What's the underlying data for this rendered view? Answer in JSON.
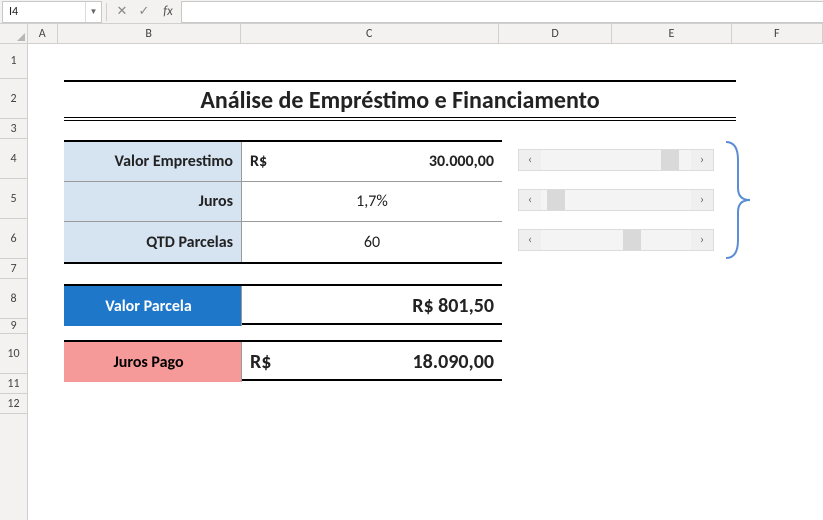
{
  "name_box": "I4",
  "formula_bar": {
    "cancel": "✕",
    "confirm": "✓",
    "fx": "fx",
    "value": ""
  },
  "columns": {
    "A": "A",
    "B": "B",
    "C": "C",
    "D": "D",
    "E": "E",
    "F": "F"
  },
  "rows": {
    "r1": "1",
    "r2": "2",
    "r3": "3",
    "r4": "4",
    "r5": "5",
    "r6": "6",
    "r7": "7",
    "r8": "8",
    "r9": "9",
    "r10": "10",
    "r11": "11",
    "r12": "12"
  },
  "title": "Análise de Empréstimo e Financiamento",
  "inputs": {
    "loan": {
      "label": "Valor Emprestimo",
      "prefix": "R$",
      "value": "30.000,00"
    },
    "rate": {
      "label": "Juros",
      "value": "1,7%"
    },
    "n": {
      "label": "QTD Parcelas",
      "value": "60"
    }
  },
  "outputs": {
    "installment": {
      "label": "Valor Parcela",
      "value": "R$ 801,50"
    },
    "interest_paid": {
      "label": "Juros Pago",
      "prefix": "R$",
      "value": "18.090,00"
    }
  },
  "scroll": {
    "left_glyph": "‹",
    "right_glyph": "›"
  },
  "col_widths": {
    "A": 30,
    "B": 184,
    "C": 260,
    "D": 114,
    "E": 120,
    "F": 92
  },
  "row_heights": {
    "1": 35,
    "2": 40,
    "3": 20,
    "4": 40,
    "5": 40,
    "6": 40,
    "7": 20,
    "8": 40,
    "9": 15,
    "10": 40,
    "11": 20,
    "12": 20
  }
}
